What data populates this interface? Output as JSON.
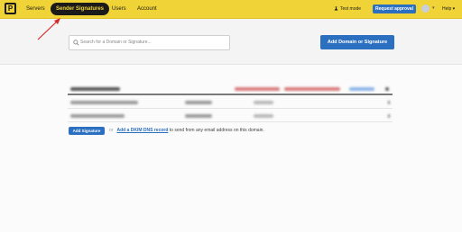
{
  "topbar": {
    "logo_letter": "P",
    "nav": [
      {
        "label": "Servers"
      },
      {
        "label": "Sender Signatures",
        "active": true
      },
      {
        "label": "Users"
      },
      {
        "label": "Account"
      }
    ],
    "test_mode_label": "Test mode",
    "request_button": "Request approval",
    "help_label": "Help"
  },
  "search": {
    "placeholder": "Search for a Domain or Signature..."
  },
  "add_domain_button": "Add Domain or Signature",
  "add_signature_button": "Add Signature",
  "or_label": "or",
  "dkim_link": "Add a DKIM DNS record",
  "dkim_suffix": "to send from any email address on this domain.",
  "colors": {
    "brand_yellow": "#f0d437",
    "primary_blue": "#2b6fc0",
    "annotation_red": "#d42a2a"
  }
}
